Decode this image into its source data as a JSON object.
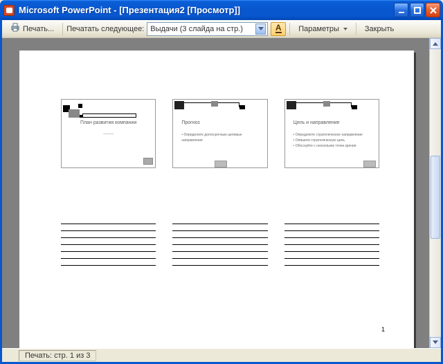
{
  "titlebar": {
    "app_name": "Microsoft PowerPoint",
    "doc_title": "[Презентация2 [Просмотр]]"
  },
  "toolbar": {
    "print_label": "Печать...",
    "print_what_label": "Печатать следующее:",
    "print_what_value": "Выдачи (3 слайда на стр.)",
    "options_label": "Параметры",
    "close_label": "Закрыть"
  },
  "page": {
    "number": "1",
    "slides": [
      {
        "title": "План развития компании",
        "subtitle": "———",
        "bullets": []
      },
      {
        "title": "Прогноз",
        "subtitle": "",
        "bullets": [
          "Определите долгосрочные целевые направления"
        ]
      },
      {
        "title": "Цель и направление",
        "subtitle": "",
        "bullets": [
          "Определите стратегическое направление",
          "Опишите стратегическую цель",
          "Обоснуйте с нескольких точек зрения"
        ]
      }
    ]
  },
  "statusbar": {
    "text": "Печать: стр. 1 из 3"
  }
}
